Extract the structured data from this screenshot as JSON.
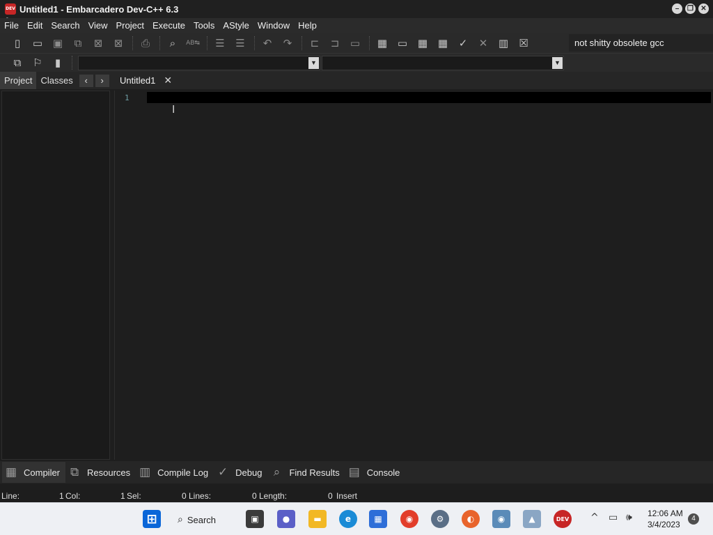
{
  "window": {
    "title": "Untitled1 - Embarcadero Dev-C++ 6.3",
    "app_icon_text": "DEV C++",
    "controls": [
      "minimize-icon",
      "restore-icon",
      "close-icon"
    ]
  },
  "menu": {
    "items": [
      "File",
      "Edit",
      "Search",
      "View",
      "Project",
      "Execute",
      "Tools",
      "AStyle",
      "Window",
      "Help"
    ]
  },
  "toolbar": {
    "compiler_label": "not shitty obsolete gcc",
    "icons_row1": [
      "new-file-icon",
      "open-icon",
      "save-icon",
      "save-all-icon",
      "close-file-icon",
      "close-all-icon",
      "print-icon",
      "find-icon",
      "replace-icon",
      "indent-icon",
      "unindent-icon",
      "undo-icon",
      "redo-icon",
      "bookmark-in-icon",
      "bookmark-out-icon",
      "comment-icon",
      "compile-icon",
      "run-icon",
      "compile-run-icon",
      "rebuild-icon",
      "syntax-check-icon",
      "stop-icon",
      "chart-icon",
      "delete-icon"
    ],
    "icons_row2": [
      "project-add-icon",
      "bookmark-icon",
      "bookmark-toggle-icon"
    ]
  },
  "left_panel": {
    "tabs": [
      "Project",
      "Classes"
    ],
    "active_tab": "Project",
    "prev_arrow": "‹",
    "next_arrow": "›"
  },
  "editor": {
    "tab_title": "Untitled1",
    "tab_close": "✕",
    "line_numbers": [
      "1"
    ]
  },
  "bottom_tabs": [
    "Compiler",
    "Resources",
    "Compile Log",
    "Debug",
    "Find Results",
    "Console"
  ],
  "statusbar": {
    "line_label": "Line:",
    "line_value": "1",
    "col_label": "Col:",
    "col_value": "1",
    "sel_label": "Sel:",
    "sel_value": "0",
    "lines_label": "Lines:",
    "lines_value": "0",
    "length_label": "Length:",
    "length_value": "0",
    "mode": "Insert"
  },
  "taskbar": {
    "search_label": "Search",
    "time": "12:06 AM",
    "date": "3/4/2023",
    "notification_count": "4",
    "colors": {
      "windows": "#0a66d8",
      "edge": "#1a8bd6",
      "chrome": "#e23d2a",
      "devcpp": "#c72626"
    }
  }
}
